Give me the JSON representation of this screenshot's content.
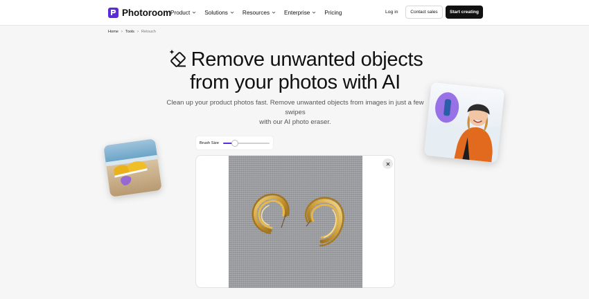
{
  "brand": {
    "name": "Photoroom",
    "accent_color": "#5b2bd8",
    "icon": "photoroom-logo-icon"
  },
  "nav": {
    "items": [
      {
        "label": "Product",
        "has_dropdown": true
      },
      {
        "label": "Solutions",
        "has_dropdown": true
      },
      {
        "label": "Resources",
        "has_dropdown": true
      },
      {
        "label": "Enterprise",
        "has_dropdown": true
      },
      {
        "label": "Pricing",
        "has_dropdown": false
      }
    ],
    "login_label": "Log in",
    "contact_label": "Contact sales",
    "start_label": "Start creating"
  },
  "breadcrumb": {
    "items": [
      "Home",
      "Tools"
    ],
    "current": "Retouch"
  },
  "hero": {
    "icon": "eraser-icon",
    "title_line1": "Remove unwanted objects",
    "title_line2": "from your photos with AI",
    "subtitle_line1": "Clean up your product photos fast. Remove unwanted objects from images in just a few swipes",
    "subtitle_line2": "with our AI photo eraser."
  },
  "editor": {
    "brush_label": "Brush Size",
    "brush_level": 0.25,
    "close_icon": "close-icon",
    "image": "gold-hoop-earrings-on-linen-photo"
  },
  "side_cards": {
    "left": "sneakers-on-beach-photo",
    "right": "smiling-woman-in-snow-photo"
  }
}
